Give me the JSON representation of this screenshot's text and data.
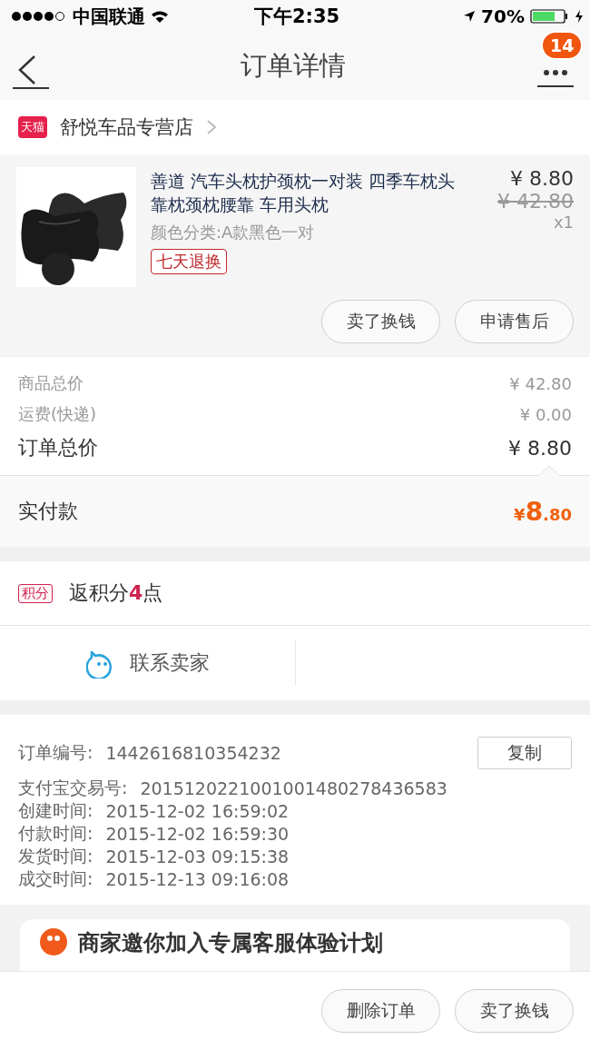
{
  "status_bar": {
    "carrier": "中国联通",
    "time": "下午2:35",
    "battery": "70%"
  },
  "nav": {
    "title": "订单详情",
    "badge": "14"
  },
  "shop": {
    "name": "舒悦车品专营店",
    "tag": "天猫"
  },
  "product": {
    "title": "善道 汽车头枕护颈枕一对装 四季车枕头靠枕颈枕腰靠 车用头枕",
    "variant": "颜色分类:A款黑色一对",
    "guarantee": "七天退换",
    "price": "¥ 8.80",
    "original_price": "¥ 42.80",
    "quantity": "x1",
    "actions": [
      "卖了换钱",
      "申请售后"
    ]
  },
  "totals": [
    {
      "label": "商品总价",
      "value": "¥ 42.80",
      "kind": "minor"
    },
    {
      "label": "运费(快递)",
      "value": "¥ 0.00",
      "kind": "minor"
    },
    {
      "label": "订单总价",
      "value": "¥ 8.80",
      "kind": "major"
    }
  ],
  "paid": {
    "label": "实付款",
    "symbol": "¥",
    "whole": "8",
    "fraction": ".80"
  },
  "points": {
    "tag": "积分",
    "text": "返积分**4**点"
  },
  "contact": {
    "label": "联系卖家"
  },
  "order_info": {
    "copy_button": "复制",
    "rows": [
      {
        "label": "订单编号:",
        "value": "1442616810354232"
      },
      {
        "label": "支付宝交易号:",
        "value": "2015120221001001480278436583"
      },
      {
        "label": "创建时间:",
        "value": "2015-12-02 16:59:02"
      },
      {
        "label": "付款时间:",
        "value": "2015-12-02 16:59:30"
      },
      {
        "label": "发货时间:",
        "value": "2015-12-03 09:15:38"
      },
      {
        "label": "成交时间:",
        "value": "2015-12-13 09:16:08"
      }
    ]
  },
  "promo_card": {
    "title": "商家邀你加入专属客服体验计划"
  },
  "bottom_actions": [
    "删除订单",
    "卖了换钱"
  ]
}
